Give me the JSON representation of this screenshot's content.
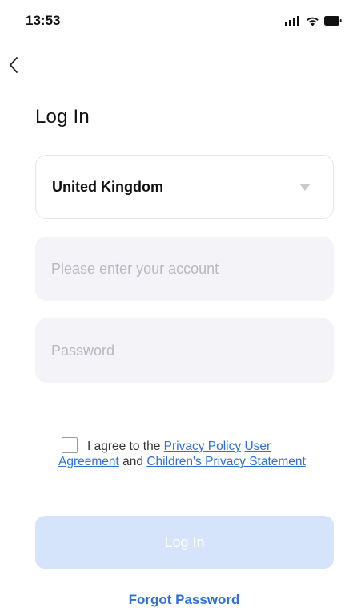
{
  "status_bar": {
    "time": "13:53",
    "icons": [
      "signal-icon",
      "wifi-icon",
      "battery-icon"
    ]
  },
  "nav": {
    "back_icon": "chevron-left-icon"
  },
  "title": "Log In",
  "country": {
    "value": "United Kingdom",
    "icon": "dropdown-triangle-icon"
  },
  "account": {
    "placeholder": "Please enter your account",
    "value": ""
  },
  "password": {
    "placeholder": "Password",
    "value": ""
  },
  "agreement": {
    "checked": false,
    "prefix": "I agree to the",
    "privacy_policy": "Privacy Policy",
    "user_agreement": "User Agreement",
    "and": "and",
    "childrens_privacy": "Children's Privacy Statement"
  },
  "login_button": {
    "label": "Log In",
    "enabled": false
  },
  "forgot_password": "Forgot Password",
  "colors": {
    "accent": "#2f6fd8",
    "button_disabled": "#d5e4fb",
    "field_bg": "#f3f3f8",
    "placeholder": "#b9b9c2"
  }
}
